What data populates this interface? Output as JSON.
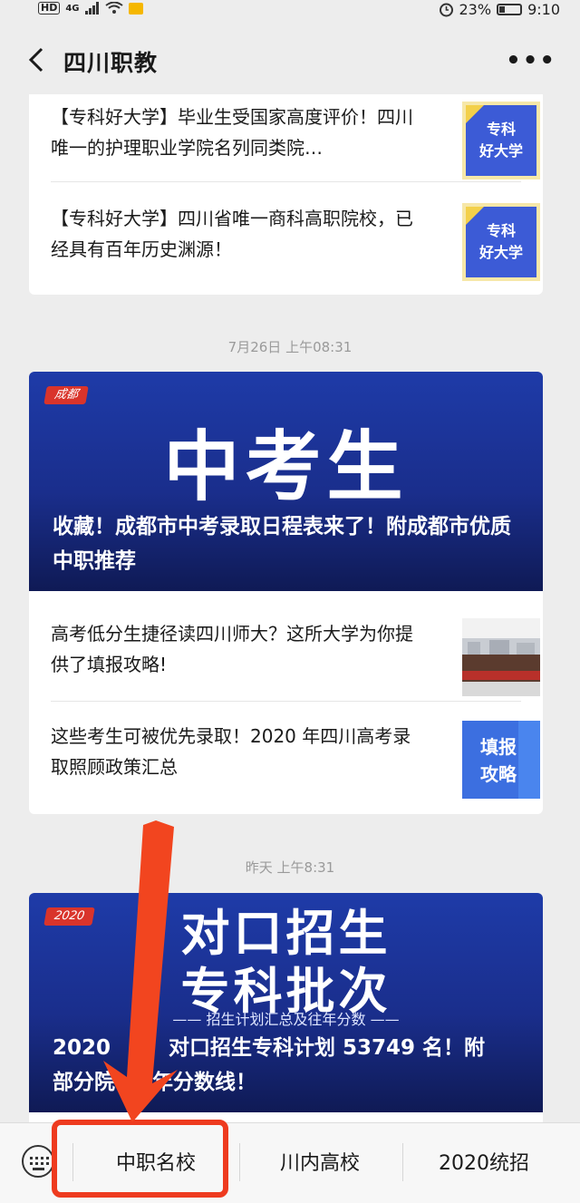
{
  "status": {
    "hd": "HD",
    "net": "4G",
    "battery": "23%",
    "time": "9:10"
  },
  "nav": {
    "title": "四川职教",
    "more": "•••"
  },
  "card1": {
    "items": [
      {
        "text": "【专科好大学】毕业生受国家高度评价！四川唯一的护理职业学院名列同类院…",
        "thumb": [
          "专科",
          "好大学"
        ]
      },
      {
        "text": "【专科好大学】四川省唯一商科高职院校，已经具有百年历史渊源！",
        "thumb": [
          "专科",
          "好大学"
        ]
      }
    ]
  },
  "time1": "7月26日 上午08:31",
  "card2": {
    "hero_tag": "成都",
    "hero_big": "中考生",
    "hero_title": "收藏！成都市中考录取日程表来了！附成都市优质中职推荐",
    "items": [
      {
        "text": "高考低分生捷径读四川师大？这所大学为你提供了填报攻略!"
      },
      {
        "text": "这些考生可被优先录取！2020 年四川高考录取照顾政策汇总",
        "thumb": [
          "填报",
          "攻略"
        ]
      }
    ]
  },
  "time2": "昨天 上午8:31",
  "card3": {
    "hero_tag": "2020",
    "hero_big1": "对口招生",
    "hero_big2": "专科批次",
    "hero_sub": "—— 招生计划汇总及往年分数 ——",
    "hero_title_a": "2020",
    "hero_title_b": "对口招生专科计划 53749 名！附",
    "hero_title_c": "部分院",
    "hero_title_d": "往年分数线！"
  },
  "menu": {
    "items": [
      "中职名校",
      "川内高校",
      "2020统招"
    ]
  },
  "colors": {
    "accent": "#ee3b1f",
    "hero": "#1a2e8c",
    "thumb_blue": "#3c5bd6"
  }
}
